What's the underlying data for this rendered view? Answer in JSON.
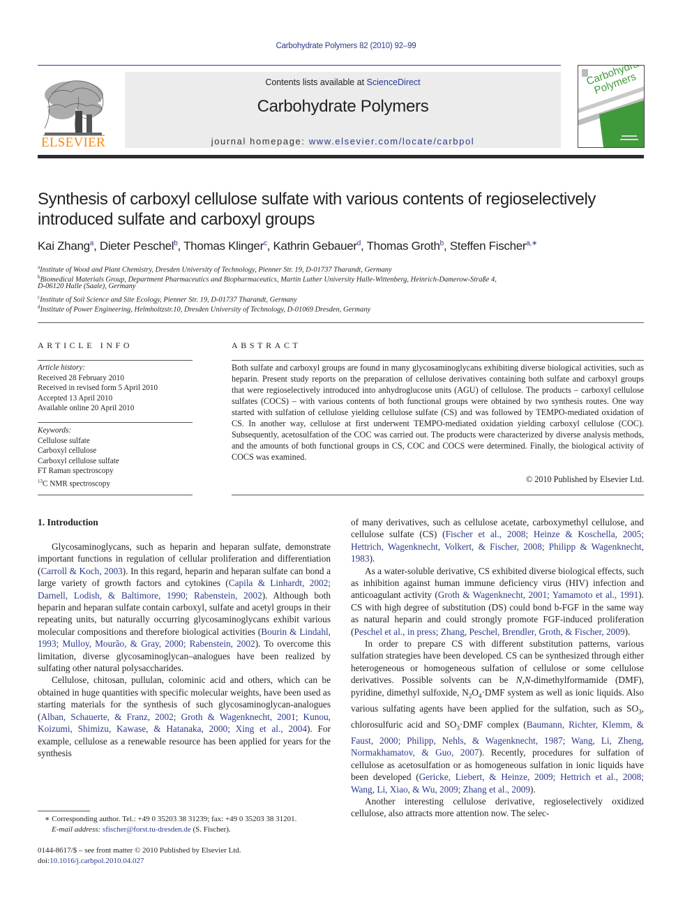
{
  "header": {
    "running_head": "Carbohydrate Polymers 82 (2010) 92–99",
    "contents_prefix": "Contents lists available at ",
    "contents_link": "ScienceDirect",
    "journal_title": "Carbohydrate Polymers",
    "homepage_prefix": "journal homepage: ",
    "homepage_link": "www.elsevier.com/locate/carbpol",
    "publisher_logo_text": "ELSEVIER",
    "cover_title_line1": "Carbohydrate",
    "cover_title_line2": "Polymers",
    "colors": {
      "link": "#2a3a8c",
      "elsevier_orange": "#f08a1c",
      "cover_green": "#3e9a3a",
      "banner_gray": "#ececec"
    }
  },
  "article": {
    "title": "Synthesis of carboxyl cellulose sulfate with various contents of regioselectively introduced sulfate and carboxyl groups",
    "authors": [
      {
        "name": "Kai Zhang",
        "sup": "a"
      },
      {
        "name": "Dieter Peschel",
        "sup": "b"
      },
      {
        "name": "Thomas Klinger",
        "sup": "c"
      },
      {
        "name": "Kathrin Gebauer",
        "sup": "d"
      },
      {
        "name": "Thomas Groth",
        "sup": "b"
      },
      {
        "name": "Steffen Fischer",
        "sup": "a,∗"
      }
    ],
    "affiliations": [
      {
        "sup": "a",
        "text": "Institute of Wood and Plant Chemistry, Dresden University of Technology, Pienner Str. 19, D-01737 Tharandt, Germany"
      },
      {
        "sup": "b",
        "text": "Biomedical Materials Group, Department Pharmaceutics and Biopharmaceutics, Martin Luther University Halle-Wittenberg, Heinrich-Damerow-Straße 4,"
      },
      {
        "sup": "",
        "text": "D-06120 Halle (Saale), Germany"
      },
      {
        "sup": "c",
        "text": "Institute of Soil Science and Site Ecology, Pienner Str. 19, D-01737 Tharandt, Germany"
      },
      {
        "sup": "d",
        "text": "Institute of Power Engineering, Helmholtzstr.10, Dresden University of Technology, D-01069 Dresden, Germany"
      }
    ]
  },
  "article_info": {
    "heading": "ARTICLE INFO",
    "history_label": "Article history:",
    "history": [
      "Received 28 February 2010",
      "Received in revised form 5 April 2010",
      "Accepted 13 April 2010",
      "Available online 20 April 2010"
    ],
    "keywords_label": "Keywords:",
    "keywords": [
      "Cellulose sulfate",
      "Carboxyl cellulose",
      "Carboxyl cellulose sulfate",
      "FT Raman spectroscopy"
    ],
    "keyword_last_sup": "13",
    "keyword_last_text": "C NMR spectroscopy"
  },
  "abstract": {
    "heading": "ABSTRACT",
    "text": "Both sulfate and carboxyl groups are found in many glycosaminoglycans exhibiting diverse biological activities, such as heparin. Present study reports on the preparation of cellulose derivatives containing both sulfate and carboxyl groups that were regioselectively introduced into anhydroglucose units (AGU) of cellulose. The products – carboxyl cellulose sulfates (COCS) – with various contents of both functional groups were obtained by two synthesis routes. One way started with sulfation of cellulose yielding cellulose sulfate (CS) and was followed by TEMPO-mediated oxidation of CS. In another way, cellulose at first underwent TEMPO-mediated oxidation yielding carboxyl cellulose (COC). Subsequently, acetosulfation of the COC was carried out. The products were characterized by diverse analysis methods, and the amounts of both functional groups in CS, COC and COCS were determined. Finally, the biological activity of COCS was examined.",
    "copyright": "© 2010 Published by Elsevier Ltd."
  },
  "body": {
    "section_heading": "1.  Introduction",
    "left": {
      "p1": [
        {
          "t": "Glycosaminoglycans, such as heparin and heparan sulfate, demonstrate important functions in regulation of cellular proliferation and differentiation ("
        },
        {
          "l": "Carroll & Koch, 2003"
        },
        {
          "t": "). In this regard, heparin and heparan sulfate can bond a large variety of growth factors and cytokines ("
        },
        {
          "l": "Capila & Linhardt, 2002; Darnell, Lodish, & Baltimore, 1990; Rabenstein, 2002"
        },
        {
          "t": "). Although both heparin and heparan sulfate contain carboxyl, sulfate and acetyl groups in their repeating units, but naturally occurring glycosaminoglycans exhibit various molecular compositions and therefore biological activities ("
        },
        {
          "l": "Bourin & Lindahl, 1993; Mulloy, Mourão, & Gray, 2000; Rabenstein, 2002"
        },
        {
          "t": "). To overcome this limitation, diverse glycosaminoglycan–analogues have been realized by sulfating other natural polysaccharides."
        }
      ],
      "p2": [
        {
          "t": "Cellulose, chitosan, pullulan, colominic acid and others, which can be obtained in huge quantities with specific molecular weights, have been used as starting materials for the synthesis of such glycosaminoglycan-analogues ("
        },
        {
          "l": "Alban, Schauerte, & Franz, 2002; Groth & Wagenknecht, 2001; Kunou, Koizumi, Shimizu, Kawase, & Hatanaka, 2000; Xing et al., 2004"
        },
        {
          "t": "). For example, cellulose as a renewable resource has been applied for years for the synthesis"
        }
      ]
    },
    "right": {
      "p0": [
        {
          "t": "of many derivatives, such as cellulose acetate, carboxymethyl cellulose, and cellulose sulfate (CS) ("
        },
        {
          "l": "Fischer et al., 2008; Heinze & Koschella, 2005; Hettrich, Wagenknecht, Volkert, & Fischer, 2008; Philipp & Wagenknecht, 1983"
        },
        {
          "t": ")."
        }
      ],
      "p1": [
        {
          "t": "As a water-soluble derivative, CS exhibited diverse biological effects, such as inhibition against human immune deficiency virus (HIV) infection and anticoagulant activity ("
        },
        {
          "l": "Groth & Wagenknecht, 2001; Yamamoto et al., 1991"
        },
        {
          "t": "). CS with high degree of substitution (DS) could bond b-FGF in the same way as natural heparin and could strongly promote FGF-induced proliferation ("
        },
        {
          "l": "Peschel et al., in press; Zhang, Peschel, Brendler, Groth, & Fischer, 2009"
        },
        {
          "t": ")."
        }
      ],
      "p2": [
        {
          "t": "In order to prepare CS with different substitution patterns, various sulfation strategies have been developed. CS can be synthesized through either heterogeneous or homogeneous sulfation of cellulose or some cellulose derivatives. Possible solvents can be "
        },
        {
          "i": "N,N"
        },
        {
          "t": "-dimethylformamide (DMF), pyridine, dimethyl sulfoxide, N"
        },
        {
          "sub": "2"
        },
        {
          "t": "O"
        },
        {
          "sub": "4"
        },
        {
          "t": "·DMF system as well as ionic liquids. Also various sulfating agents have been applied for the sulfation, such as SO"
        },
        {
          "sub": "3"
        },
        {
          "t": ", chlorosulfuric acid and SO"
        },
        {
          "sub": "3"
        },
        {
          "t": "·DMF complex ("
        },
        {
          "l": "Baumann, Richter, Klemm, & Faust, 2000; Philipp, Nehls, & Wagenknecht, 1987; Wang, Li, Zheng, Normakhamatov, & Guo, 2007"
        },
        {
          "t": "). Recently, procedures for sulfation of cellulose as acetosulfation or as homogeneous sulfation in ionic liquids have been developed ("
        },
        {
          "l": "Gericke, Liebert, & Heinze, 2009; Hettrich et al., 2008; Wang, Li, Xiao, & Wu, 2009; Zhang et al., 2009"
        },
        {
          "t": ")."
        }
      ],
      "p3": [
        {
          "t": "Another interesting cellulose derivative, regioselectively oxidized cellulose, also attracts more attention now. The selec-"
        }
      ]
    }
  },
  "footnote": {
    "star": "∗",
    "corresponding": " Corresponding author. Tel.: +49 0 35203 38 31239; fax: +49 0 35203 38 31201.",
    "email_label": "E-mail address: ",
    "email": "sfischer@forst.tu-dresden.de",
    "email_suffix": " (S. Fischer)."
  },
  "front_matter": {
    "line1": "0144-8617/$ – see front matter © 2010 Published by Elsevier Ltd.",
    "doi_prefix": "doi:",
    "doi": "10.1016/j.carbpol.2010.04.027"
  }
}
